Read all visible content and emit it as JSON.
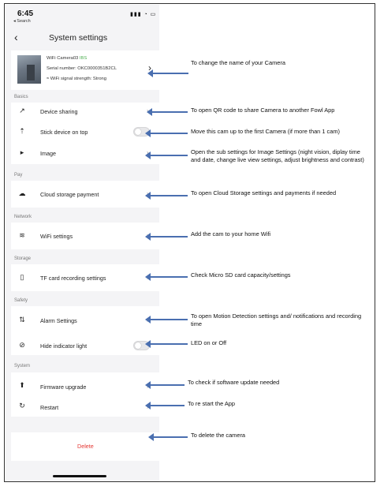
{
  "status_bar": {
    "time": "6:45",
    "back": "◂ Search",
    "icons": "▮▮▮ ◔ ▭"
  },
  "nav": {
    "back_icon": "‹",
    "title": "System settings"
  },
  "camera": {
    "name": "WiFi Camera03",
    "tag": "IBS",
    "serial": "Serial number: OKC0000351B2CL",
    "wifi": "WiFi signal strength: Strong",
    "chevron": "›"
  },
  "sections": {
    "basics": "Basics",
    "pay": "Pay",
    "network": "Network",
    "storage": "Storage",
    "safety": "Safety",
    "system": "System"
  },
  "rows": {
    "device_sharing": "Device sharing",
    "stick_on_top": "Stick device on top",
    "image": "Image",
    "cloud_payment": "Cloud storage payment",
    "wifi_settings": "WiFi settings",
    "tf_card": "TF card recording settings",
    "alarm_settings": "Alarm Settings",
    "hide_indicator": "Hide indicator light",
    "firmware": "Firmware upgrade",
    "restart": "Restart"
  },
  "chevron": "›",
  "delete_label": "Delete",
  "toggles": {
    "stick_on_top": false,
    "hide_indicator": false
  },
  "annotations": {
    "name": "To change the name of your Camera",
    "sharing": "To open QR code to share Camera to another Fowl App",
    "stick": "Move this cam up to the first Camera (if more than 1 cam)",
    "image": "Open the sub settings for Image Settings (night vision, diplay time and date, change live view settings, adjust brightness and contrast)",
    "cloud": "To open Cloud Storage settings and payments if needed",
    "wifi": "Add the cam to your home Wifi",
    "tf": "Check Micro SD card capacity/settings",
    "alarm": "To open Motion Detection settings and/ notifications and recording time",
    "led": "LED on or Off",
    "firmware": "To check if software update needed",
    "restart": "To re start the App",
    "delete": "To delete the camera"
  },
  "colors": {
    "arrow": "#4a6fb0",
    "delete": "#e53935",
    "tag": "#4caf50"
  }
}
